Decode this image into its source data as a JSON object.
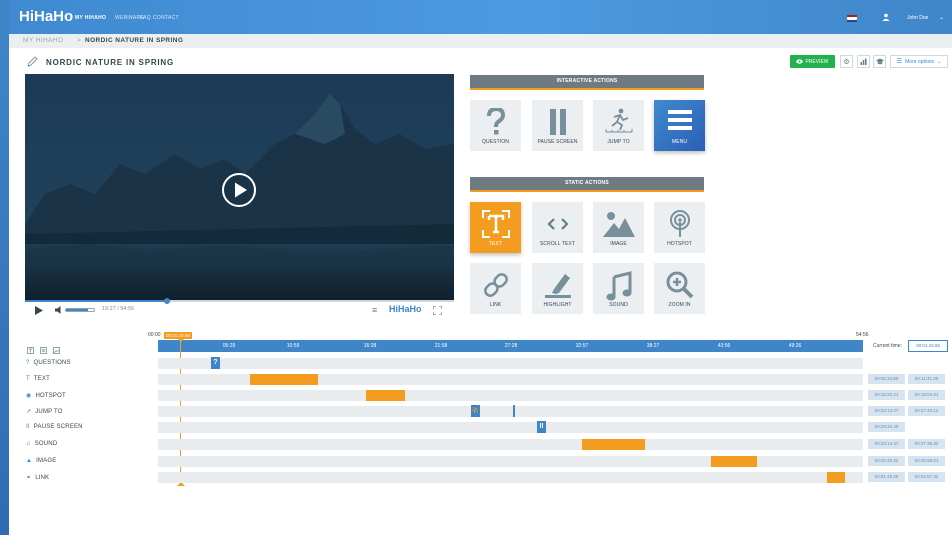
{
  "app": {
    "logo": "HiHaHo"
  },
  "nav": [
    {
      "label": "MY HIHAHO",
      "active": true
    },
    {
      "label": "WEBINARS",
      "active": false
    },
    {
      "label": "FAQ",
      "active": false
    },
    {
      "label": "CONTACT",
      "active": false
    }
  ],
  "user": {
    "name": "John Doe"
  },
  "breadcrumb": {
    "home": "MY HIHAHO",
    "sep": ">",
    "current": "NORDIC NATURE IN SPRING"
  },
  "page": {
    "title": "NORDIC NATURE IN SPRING"
  },
  "toolbar": {
    "preview_label": "PREVIEW",
    "more_label": "More options"
  },
  "player": {
    "time": "19:27 / 54:56",
    "logo": "HiHaHo",
    "progress": 0.33,
    "volume": 0.8
  },
  "interactive_actions": {
    "title": "INTERACTIVE ACTIONS",
    "tiles": [
      {
        "label": "QUESTION",
        "icon": "question-icon"
      },
      {
        "label": "PAUSE SCREEN",
        "icon": "pause-icon"
      },
      {
        "label": "JUMP TO",
        "icon": "jump-icon"
      },
      {
        "label": "MENU",
        "icon": "menu-icon"
      }
    ]
  },
  "static_actions": {
    "title": "STATIC ACTIONS",
    "tiles": [
      {
        "label": "TEXT",
        "icon": "text-icon"
      },
      {
        "label": "SCROLL TEXT",
        "icon": "scroll-text-icon"
      },
      {
        "label": "IMAGE",
        "icon": "image-icon"
      },
      {
        "label": "HOTSPOT",
        "icon": "hotspot-icon"
      },
      {
        "label": "LINK",
        "icon": "link-icon"
      },
      {
        "label": "HIGHLIGHT",
        "icon": "highlight-icon"
      },
      {
        "label": "SOUND",
        "icon": "sound-icon"
      },
      {
        "label": "ZOOM IN",
        "icon": "zoom-in-icon"
      }
    ]
  },
  "timeline": {
    "start": "00:00",
    "end": "54:56",
    "marker": "00:01:43.68",
    "ticks": [
      "05:29",
      "10:59",
      "16:28",
      "21:58",
      "27:28",
      "32:57",
      "38:27",
      "43:56",
      "49:26"
    ],
    "current_time_label": "Current time:",
    "current_time": "00:01:43.68",
    "rows": [
      {
        "label": "QUESTIONS",
        "icon": "?",
        "badges": []
      },
      {
        "label": "TEXT",
        "icon": "T",
        "badges": [
          "00:06:34.59",
          "00:11:41.38"
        ]
      },
      {
        "label": "HOTSPOT",
        "icon": "◉",
        "badges": [
          "00:15:20.21",
          "00:18:04.61"
        ]
      },
      {
        "label": "JUMP TO",
        "icon": "↗",
        "badges": [
          "00:23:13.07",
          "00:27:43.12"
        ]
      },
      {
        "label": "PAUSE SCREEN",
        "icon": "II",
        "badges": [
          "00:29:34.40"
        ]
      },
      {
        "label": "SOUND",
        "icon": "♫",
        "badges": [
          "00:33:14.37",
          "00:37:36.32"
        ]
      },
      {
        "label": "IMAGE",
        "icon": "▲",
        "badges": [
          "00:42:33.32",
          "00:45:58.01"
        ]
      },
      {
        "label": "LINK",
        "icon": "⚭",
        "badges": [
          "00:51:45.05",
          "00:52:57.32"
        ]
      }
    ]
  },
  "colors": {
    "accent": "#3f86c9",
    "orange": "#f39c1f",
    "green": "#22b14c",
    "section": "#6f7b82"
  }
}
